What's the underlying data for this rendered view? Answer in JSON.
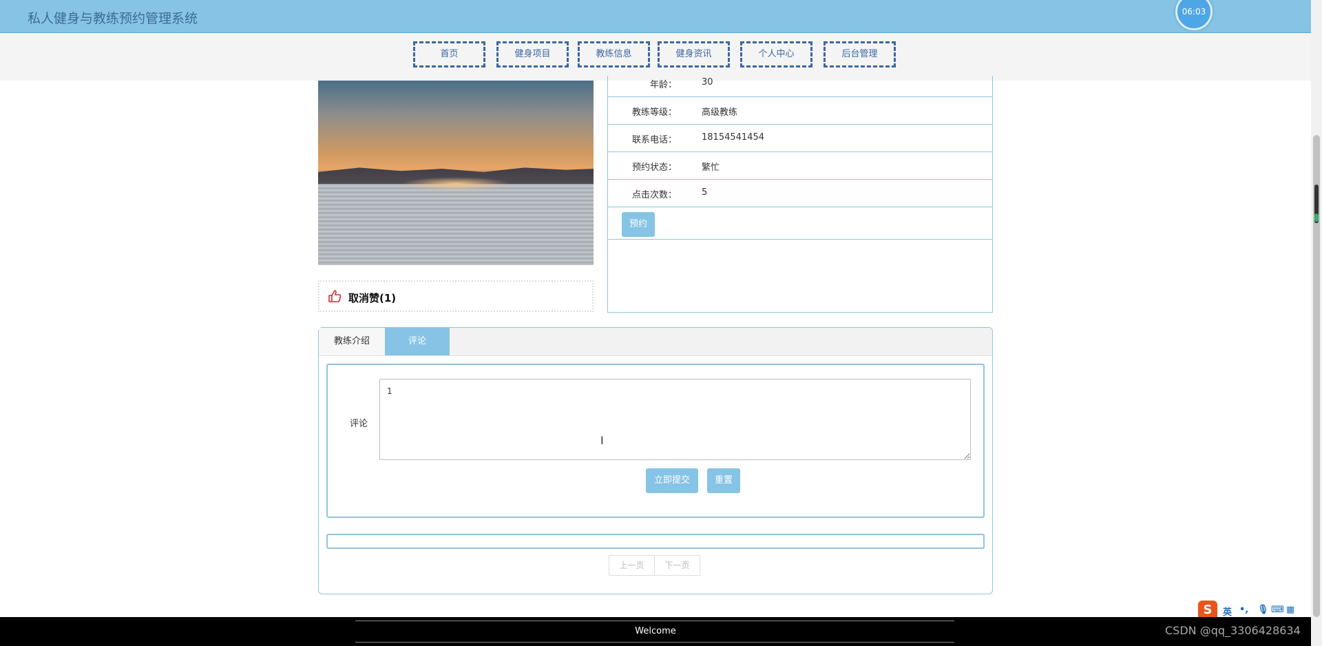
{
  "header": {
    "title": "私人健身与教练预约管理系统",
    "clock": "06:03"
  },
  "nav": {
    "items": [
      {
        "label": "首页"
      },
      {
        "label": "健身项目"
      },
      {
        "label": "教练信息"
      },
      {
        "label": "健身资讯"
      },
      {
        "label": "个人中心"
      },
      {
        "label": "后台管理"
      }
    ]
  },
  "like": {
    "label": "取消赞(1)"
  },
  "info": {
    "rows": [
      {
        "key": "年龄：",
        "value": "30"
      },
      {
        "key": "教练等级：",
        "value": "高级教练"
      },
      {
        "key": "联系电话：",
        "value": "18154541454"
      },
      {
        "key": "预约状态：",
        "value": "繁忙"
      },
      {
        "key": "点击次数：",
        "value": "5"
      }
    ],
    "book_button": "预约"
  },
  "tabs": [
    {
      "label": "教练介绍"
    },
    {
      "label": "评论"
    }
  ],
  "comment_form": {
    "label": "评论",
    "value": "1",
    "submit": "立即提交",
    "reset": "重置"
  },
  "pager": {
    "prev": "上一页",
    "next": "下一页"
  },
  "footer": {
    "welcome": "Welcome"
  },
  "watermark": "CSDN @qq_3306428634",
  "ime": {
    "s": "S",
    "lang": "英"
  }
}
